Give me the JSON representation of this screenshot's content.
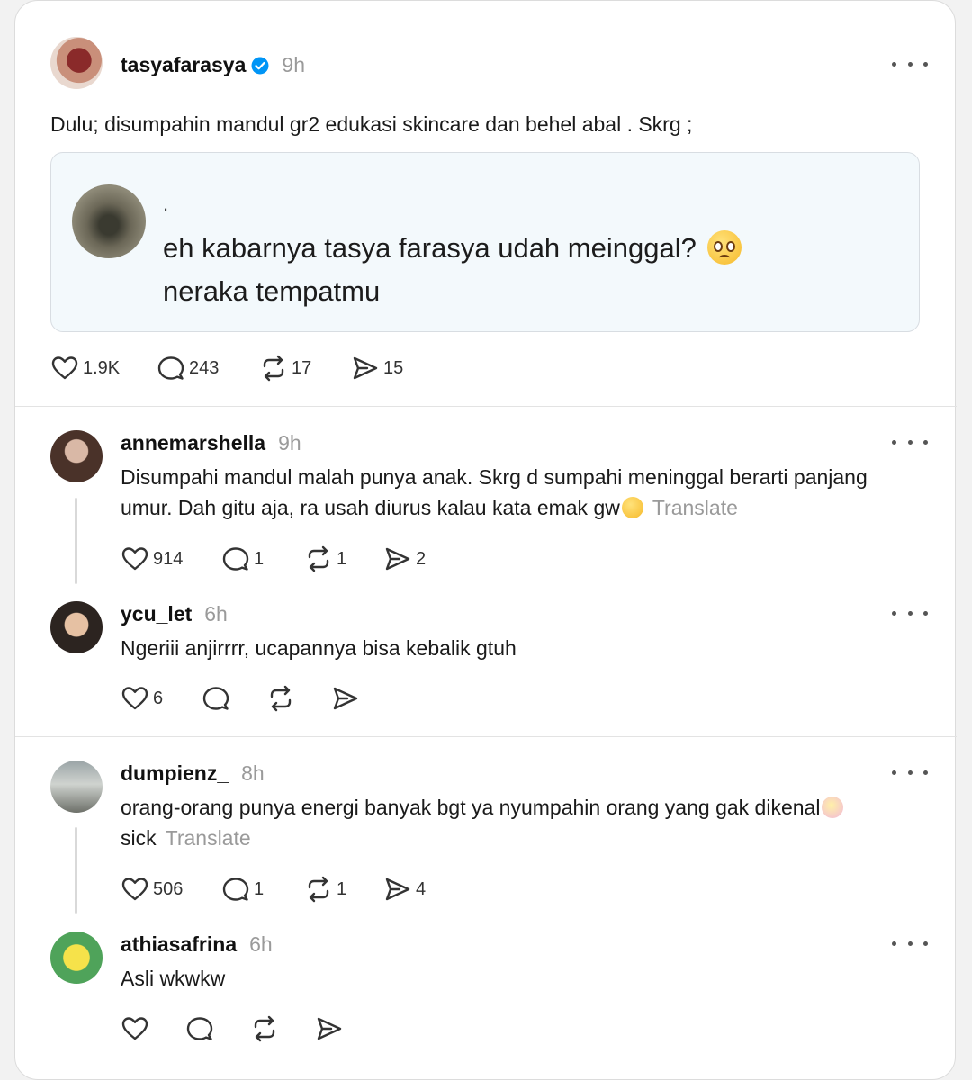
{
  "post": {
    "username": "tasyafarasya",
    "time": "9h",
    "text": "Dulu; disumpahin mandul gr2 edukasi skincare dan behel abal . Skrg ;",
    "quote": {
      "author": ".",
      "line1": "eh kabarnya tasya farasya udah meinggal?",
      "line2": "neraka tempatmu"
    },
    "likes": "1.9K",
    "replies": "243",
    "reposts": "17",
    "shares": "15"
  },
  "threads": [
    {
      "username": "annemarshella",
      "time": "9h",
      "line1": "Disumpahi mandul malah punya anak. Skrg d sumpahi meninggal berarti panjang",
      "line2": "umur. Dah gitu aja, ra usah diurus kalau kata emak gw",
      "translate": "Translate",
      "likes": "914",
      "replies": "1",
      "reposts": "1",
      "shares": "2"
    },
    {
      "username": "ycu_let",
      "time": "6h",
      "line1": "Ngeriii anjirrrr, ucapannya bisa kebalik gtuh",
      "likes": "6",
      "replies": "",
      "reposts": "",
      "shares": ""
    },
    {
      "username": "dumpienz_",
      "time": "8h",
      "line1": "orang-orang punya energi banyak bgt ya nyumpahin orang yang gak dikenal",
      "line2": "sick",
      "translate": "Translate",
      "likes": "506",
      "replies": "1",
      "reposts": "1",
      "shares": "4"
    },
    {
      "username": "athiasafrina",
      "time": "6h",
      "line1": "Asli wkwkw",
      "likes": "",
      "replies": "",
      "reposts": "",
      "shares": ""
    }
  ],
  "colors": {
    "verified": "#0095f6",
    "muted": "#9a9a9a",
    "quote_bg": "#f3f9fc"
  },
  "icons": [
    "heart-icon",
    "comment-icon",
    "repost-icon",
    "share-icon",
    "more-icon",
    "verified-badge-icon"
  ]
}
